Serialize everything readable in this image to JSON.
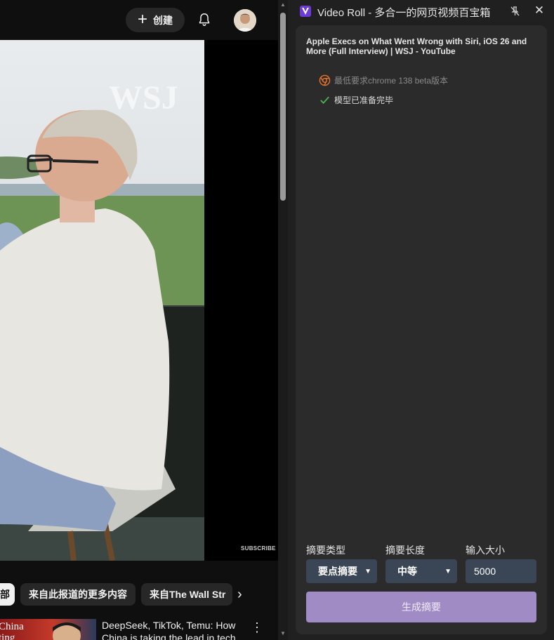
{
  "youtube": {
    "create_label": "创建",
    "chips": [
      "部",
      "来自此报道的更多内容",
      "来自The Wall Str"
    ],
    "video_watermark": "WSJ",
    "video_overlay": "SUBSCRIBE",
    "recommendation": {
      "thumb_text": "China\nting",
      "title": "DeepSeek, TikTok, Temu: How China is taking the lead in tech"
    }
  },
  "panel": {
    "app_title": "Video Roll - 多合一的网页视频百宝箱",
    "video_title": "Apple Execs on What Went Wrong with Siri, iOS 26 and More (Full Interview) | WSJ - YouTube",
    "status_min_version": "最低要求chrome 138 beta版本",
    "status_model_ready": "模型已准备完毕",
    "summary_type_label": "摘要类型",
    "summary_type_value": "要点摘要",
    "summary_length_label": "摘要长度",
    "summary_length_value": "中等",
    "input_size_label": "输入大小",
    "input_size_value": "5000",
    "generate_label": "生成摘要"
  },
  "colors": {
    "panel_bg": "#202020",
    "card_bg": "#2b2b2b",
    "control_bg": "#3a4556",
    "generate_bg": "#a08bc5",
    "ready_check": "#4caf50",
    "chrome_icon": "#e8732a"
  },
  "icons": [
    "plus-icon",
    "bell-icon",
    "avatar",
    "chevron-right-icon",
    "more-vert-icon",
    "app-logo-icon",
    "pin-off-icon",
    "close-icon",
    "chrome-icon",
    "check-icon",
    "chevron-down-icon"
  ]
}
